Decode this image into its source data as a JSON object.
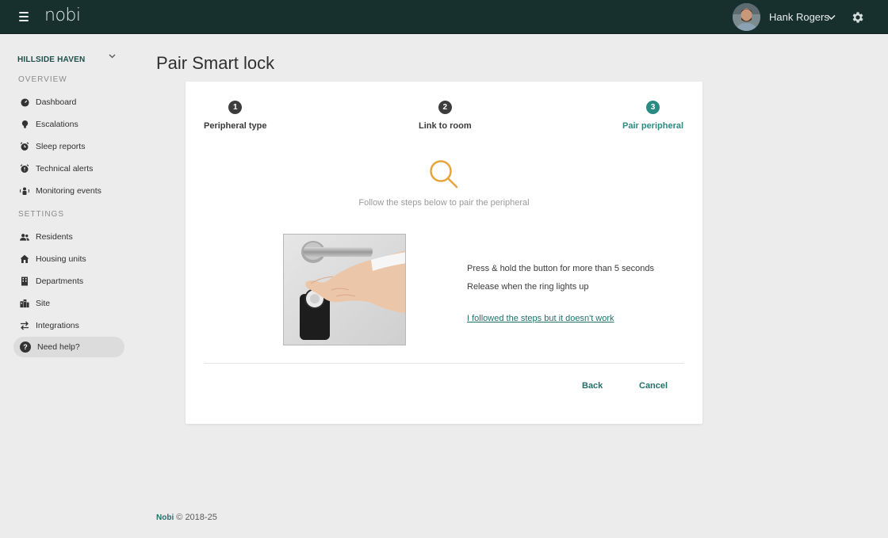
{
  "header": {
    "logo": "nobi",
    "user_name": "Hank Rogers",
    "menu_icon": "hamburger-menu-icon",
    "settings_icon": "gear-icon"
  },
  "sidebar": {
    "site_name": "HILLSIDE HAVEN",
    "overview_label": "OVERVIEW",
    "settings_label": "SETTINGS",
    "overview_items": [
      {
        "label": "Dashboard",
        "icon": "gauge-icon"
      },
      {
        "label": "Escalations",
        "icon": "lightbulb-icon"
      },
      {
        "label": "Sleep reports",
        "icon": "alarm-clock-icon"
      },
      {
        "label": "Technical alerts",
        "icon": "alarm-clock-alert-icon"
      },
      {
        "label": "Monitoring events",
        "icon": "person-waves-icon"
      }
    ],
    "settings_items": [
      {
        "label": "Residents",
        "icon": "people-icon"
      },
      {
        "label": "Housing units",
        "icon": "house-icon"
      },
      {
        "label": "Departments",
        "icon": "building-icon"
      },
      {
        "label": "Site",
        "icon": "city-icon"
      },
      {
        "label": "Integrations",
        "icon": "arrows-exchange-icon"
      }
    ],
    "help_label": "Need help?"
  },
  "page": {
    "title": "Pair Smart lock"
  },
  "modal": {
    "steps": [
      {
        "number": "1",
        "label": "Peripheral type"
      },
      {
        "number": "2",
        "label": "Link to room"
      },
      {
        "number": "3",
        "label": "Pair peripheral"
      }
    ],
    "active_step": 3,
    "intro": "Follow the steps below to pair the peripheral",
    "instruction_1": "Press & hold the button for more than 5 seconds",
    "instruction_2": "Release when the ring lights up",
    "help_link": "I followed the steps but it doesn't work",
    "back_label": "Back",
    "cancel_label": "Cancel"
  },
  "footer": {
    "brand": "Nobi",
    "copyright": "© 2018-25"
  },
  "colors": {
    "topbar": "#17302d",
    "accent": "#2a8b82",
    "link": "#23706a",
    "search_icon": "#e8a33a"
  }
}
